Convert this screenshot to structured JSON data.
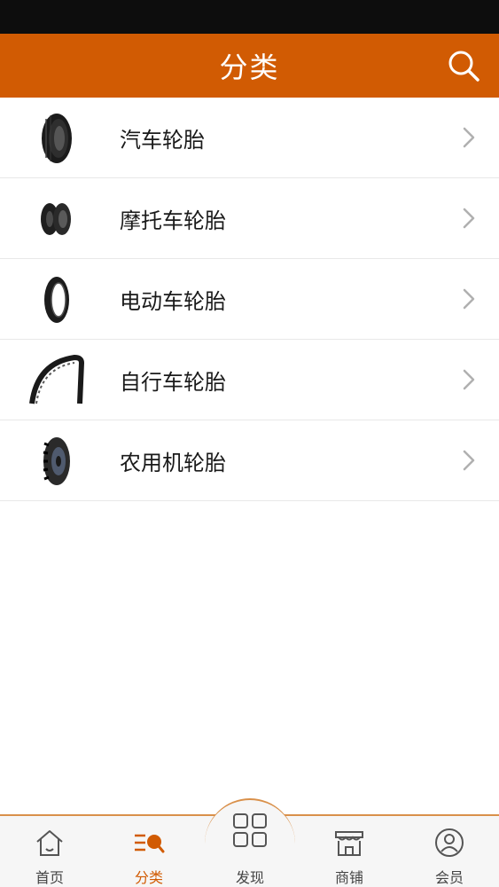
{
  "header": {
    "title": "分类",
    "search_icon": "search-icon"
  },
  "categories": [
    {
      "label": "汽车轮胎",
      "icon": "car-tire-image"
    },
    {
      "label": "摩托车轮胎",
      "icon": "motorcycle-tire-image"
    },
    {
      "label": "电动车轮胎",
      "icon": "ebike-tire-image"
    },
    {
      "label": "自行车轮胎",
      "icon": "bicycle-tire-image"
    },
    {
      "label": "农用机轮胎",
      "icon": "tractor-tire-image"
    }
  ],
  "tabbar": {
    "tabs": [
      {
        "label": "首页",
        "icon": "home-icon"
      },
      {
        "label": "分类",
        "icon": "category-icon",
        "active": true
      },
      {
        "label": "发现",
        "icon": "grid-icon"
      },
      {
        "label": "商铺",
        "icon": "store-icon"
      },
      {
        "label": "会员",
        "icon": "user-icon"
      }
    ]
  },
  "colors": {
    "brand": "#d15b03",
    "status_bar": "#0d0d0d",
    "tab_border": "#d9904a"
  }
}
